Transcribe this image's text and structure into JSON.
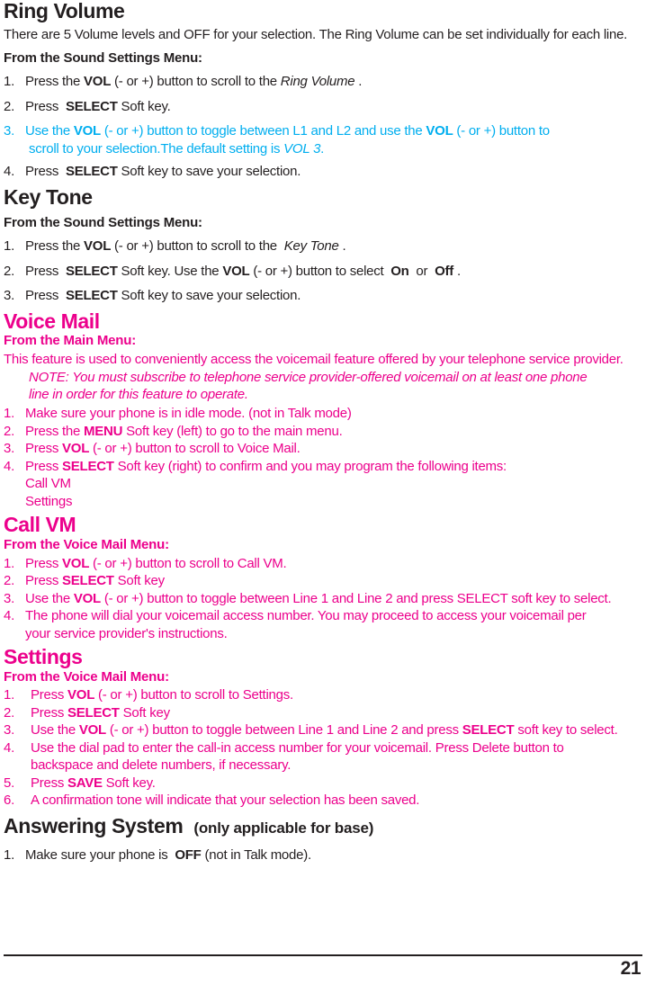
{
  "page_number": "21",
  "colors": {
    "body_text": "#231f20",
    "magenta": "#ec008c",
    "cyan": "#00aeef"
  },
  "sections": {
    "ring_volume": {
      "title": "Ring Volume",
      "intro": "There are 5 Volume levels and OFF for your selection. The Ring Volume can be set individually for each line.",
      "menu_heading": "From the Sound Settings Menu:",
      "steps": [
        {
          "num": "1.",
          "text_html": "Press the <b>VOL</b> (- or +) button to scroll to the <i>Ring Volume</i> ."
        },
        {
          "num": "2.",
          "text_html": "Press&nbsp; <b>SELECT</b> Soft key."
        },
        {
          "num": "3.",
          "text_html": "Use the <b>VOL</b> (- or +) button to toggle between L1 and L2 and use the <b>VOL</b> (- or +) button to"
        },
        {
          "num": "4.",
          "text_html": "Press&nbsp; <b>SELECT</b> Soft key to save your selection."
        }
      ],
      "step3_continuation": "scroll to your selection.The default setting is <i>VOL 3</i>."
    },
    "key_tone": {
      "title": "Key Tone",
      "menu_heading": "From the Sound Settings Menu:",
      "steps": [
        {
          "num": "1.",
          "text_html": "Press the <b>VOL</b> (- or +) button to scroll to the&nbsp; <i>Key Tone</i> ."
        },
        {
          "num": "2.",
          "text_html": "Press&nbsp; <b>SELECT</b> Soft key. Use the <b>VOL</b> (- or +) button to select&nbsp; <b>On</b>&nbsp; or&nbsp; <b>Off</b> ."
        },
        {
          "num": "3.",
          "text_html": "Press&nbsp; <b>SELECT</b> Soft key to save your selection."
        }
      ]
    },
    "voice_mail": {
      "title": "Voice Mail",
      "menu_heading": "From the Main Menu:",
      "intro": "This feature is used to conveniently access the voicemail feature offered by your telephone service provider.",
      "note_line1": "NOTE: You must subscribe to telephone service provider-offered voicemail on at least one phone",
      "note_line2": "line in order for this feature to operate.",
      "steps": [
        {
          "num": "1.",
          "text_html": "Make sure your phone is in idle mode. (not in Talk mode)"
        },
        {
          "num": "2.",
          "text_html": "Press the <b>MENU</b> Soft key (left) to go to the main menu."
        },
        {
          "num": "3.",
          "text_html": "Press <b>VOL</b> (- or +) button to scroll to Voice Mail."
        },
        {
          "num": "4.",
          "text_html": "Press <b>SELECT</b> Soft key (right) to confirm and you may program the following items:"
        }
      ],
      "program_items": [
        "Call VM",
        "Settings"
      ]
    },
    "call_vm": {
      "title": "Call VM",
      "menu_heading": "From the Voice Mail Menu:",
      "steps": [
        {
          "num": "1.",
          "text_html": "Press <b>VOL</b> (- or +) button to scroll to Call VM."
        },
        {
          "num": "2.",
          "text_html": "Press <b>SELECT</b> Soft key"
        },
        {
          "num": "3.",
          "text_html": "Use the <b>VOL</b> (- or +) button to toggle between Line 1 and Line 2 and press SELECT soft key to select."
        },
        {
          "num": "4.",
          "text_html": "The phone will dial your voicemail access number. You may proceed to access your voicemail per"
        }
      ],
      "step4_continuation": "your service provider's instructions."
    },
    "settings": {
      "title": "Settings",
      "menu_heading": "From the Voice Mail Menu:",
      "steps": [
        {
          "num": "1.",
          "text_html": "Press <b>VOL</b> (- or +) button to scroll to Settings."
        },
        {
          "num": "2.",
          "text_html": "Press <b>SELECT</b> Soft key"
        },
        {
          "num": "3.",
          "text_html": "Use the <b>VOL</b> (- or +) button to toggle between Line 1 and Line 2 and press <b>SELECT</b> soft key to select."
        },
        {
          "num": "4.",
          "text_html": "Use the dial pad to enter the call-in access number for your voicemail. Press Delete button to"
        },
        {
          "num": "5.",
          "text_html": "Press <b>SAVE</b> Soft key."
        },
        {
          "num": "6.",
          "text_html": "A confirmation tone will indicate that your selection has been saved."
        }
      ],
      "step4_continuation": "backspace and delete numbers, if necessary."
    },
    "answering_system": {
      "title": "Answering System",
      "subtitle": "(only applicable for base)",
      "steps": [
        {
          "num": "1.",
          "text_html": "Make sure your phone is&nbsp; <b>OFF</b> (not in Talk mode)."
        }
      ]
    }
  }
}
